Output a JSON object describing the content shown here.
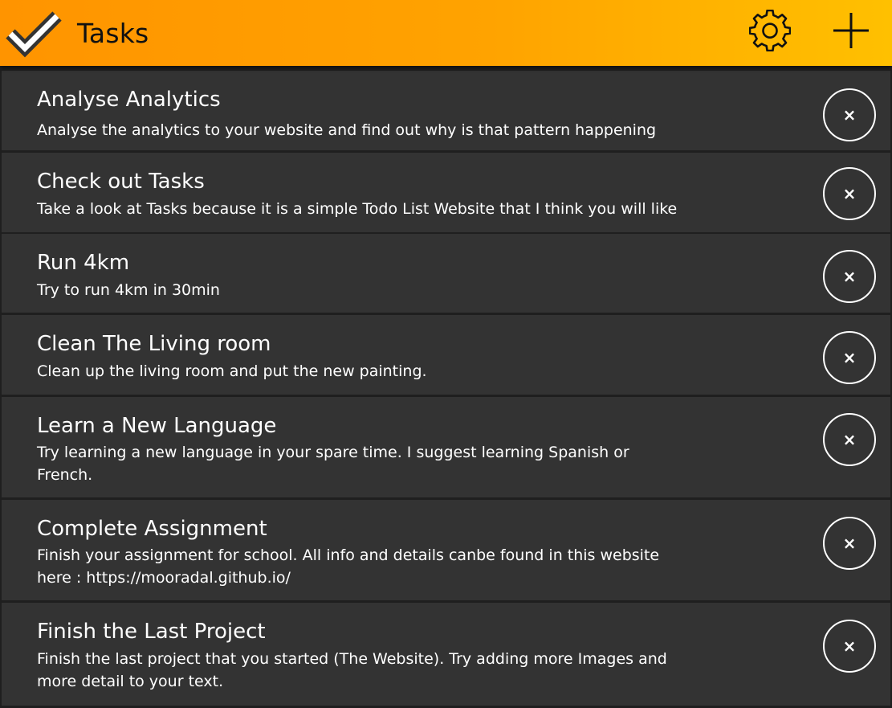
{
  "header": {
    "title": "Tasks",
    "logo_icon": "checkmark-icon",
    "settings_icon": "gear-icon",
    "add_icon": "plus-icon",
    "gradient_colors": [
      "#ff9400",
      "#ffc000"
    ]
  },
  "tasks": [
    {
      "title": "Analyse Analytics",
      "description": "Analyse the analytics to your website and find out why is that pattern happening",
      "delete_glyph": "×"
    },
    {
      "title": "Check out Tasks",
      "description": "Take a look at Tasks because it is a simple Todo List Website that I think you will like",
      "delete_glyph": "×"
    },
    {
      "title": "Run 4km",
      "description": "Try to run 4km in 30min",
      "delete_glyph": "×"
    },
    {
      "title": "Clean The Living room",
      "description": "Clean up the living room and put the new painting.",
      "delete_glyph": "×"
    },
    {
      "title": "Learn a New Language",
      "description": "Try learning a new language in your spare time. I suggest learning Spanish or French.",
      "delete_glyph": "×"
    },
    {
      "title": "Complete Assignment",
      "description": "Finish your assignment for school. All info and details canbe found in this website here : https://mooradal.github.io/",
      "delete_glyph": "×"
    },
    {
      "title": "Finish the Last Project",
      "description": "Finish the last project that you started (The Website). Try adding more Images and more detail to your text.",
      "delete_glyph": "×"
    }
  ],
  "colors": {
    "card_background": "#333333",
    "page_background": "#1f1f1f",
    "text": "#ffffff"
  }
}
